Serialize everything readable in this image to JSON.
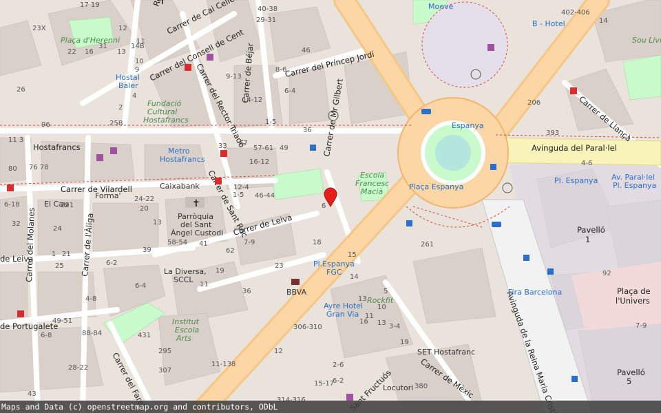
{
  "attribution": "Maps and Data (c) openstreetmap.org and contributors, ODbL",
  "streets": {
    "rector_triado_top": "Rector Triadó",
    "cai_cellers": "Carrer de Cai Cellers",
    "consell_de_cent": "Carrer del Consell de Cent",
    "rector_triado": "Carrer del Rector Triadó",
    "bejar": "Carrer de Béjar",
    "princep_jordi": "Carrer del Príncep Jordi",
    "vilardell": "Carrer de Vilardell",
    "sant_roc": "Carrer de Sant Roc",
    "leiva": "Carrer de Leiva",
    "leiva_left": "de Leiva",
    "mr_gilbert": "Carrer de Mr Gilbert",
    "molanes": "Carrer del Molanes",
    "aliga": "Carrer de l'Àliga",
    "portugalete": "de Portugalete",
    "farell": "Carrer del Farell",
    "mexic": "Carrer de Mèxic",
    "fructuos": "Sant Fructuós",
    "paral_lel": "Avinguda del Paral·lel",
    "llanca": "Carrer de Llançà",
    "reina_maria": "Avinguda de la Reina Maria Cristina"
  },
  "places": {
    "moeve": "Moeve",
    "placa_herenni": "Plaça d'Herenni",
    "hostal_baler": [
      "Hostal",
      "Baler"
    ],
    "fundacio": [
      "Fundació",
      "Cultural",
      "Hostafrancs"
    ],
    "hostafrancs": "Hostafrancs",
    "metro": [
      "Metro",
      "Hostafrancs"
    ],
    "caixabank": "Caixabank",
    "forma": "Forma'",
    "el_cau": "El Cau",
    "parroquia": [
      "Parròquia",
      "del Sant",
      "Àngel Custodi"
    ],
    "la_diversa": [
      "La Diversa,",
      "SCCL"
    ],
    "institut": [
      "Institut",
      "Escola",
      "Arts"
    ],
    "escola": [
      "Escola",
      "Francesc",
      "Macià"
    ],
    "espanya": "Espanya",
    "placa_espanya": "Plaça Espanya",
    "pl_espanya_fgc": [
      "Pl.Espanya",
      "FGC"
    ],
    "bbva": "BBVA",
    "ayre": [
      "Ayre Hotel",
      "Gran Via"
    ],
    "rockfit": "Rockfit",
    "set": "SET Hostafranc",
    "locutori": "Locutori",
    "b_hotel": "B - Hotel",
    "sou_livre": "Sou Livre",
    "pavello1": [
      "Pavelló",
      "1"
    ],
    "pavello5": [
      "Pavelló",
      "5"
    ],
    "placa_univers": [
      "Plaça de",
      "l'Univers"
    ],
    "fira": "Fira Barcelona",
    "pl_espanya_bus": "Pl. Espanya",
    "av_paral_lel": [
      "Av. Paral·lel",
      "Pl. Espanya"
    ]
  },
  "numbers": [
    "17 19",
    "23X",
    "12",
    "13",
    "14B",
    "31",
    "22",
    "16",
    "10",
    "9",
    "26",
    "11",
    "25B",
    "4",
    "2",
    "96",
    "11 3",
    "80",
    "76 78",
    "6-18",
    "291",
    "32",
    "24",
    "1",
    "21",
    "25",
    "29-31",
    "40-38",
    "46",
    "9-13",
    "14-12",
    "6-4",
    "8-6",
    "1-5",
    "36",
    "33",
    "57-61",
    "49",
    "67",
    "16-12",
    "12-4",
    "1-5",
    "46-44",
    "24-22",
    "20",
    "13",
    "39",
    "58-54",
    "41",
    "62",
    "7-9",
    "23",
    "19",
    "11",
    "36",
    "6-2",
    "6-4",
    "4-8",
    "49-51",
    "88-84",
    "6-8",
    "28-22",
    "43",
    "431",
    "295",
    "307",
    "11-138",
    "15-17",
    "314-316",
    "306-310",
    "12",
    "16",
    "13",
    "3-4",
    "261",
    "380",
    "206",
    "393",
    "402-406",
    "14",
    "4-6",
    "7-9",
    "92",
    "6",
    "19",
    "2-6",
    "6-2",
    "18",
    "15",
    "14",
    "13",
    "11",
    "10",
    "5"
  ],
  "colors": {
    "land": "#e9e3dc",
    "building": "#d9d0c9",
    "road_major": "#fcd6a4",
    "road_minor": "#ffffff",
    "park": "#c8facc",
    "plaza": "#dddde8",
    "transit_blue": "#2a6fc9",
    "poi_red": "#d62e2e"
  },
  "marker": {
    "icon": "map-pin-icon",
    "color": "#e3201b"
  }
}
